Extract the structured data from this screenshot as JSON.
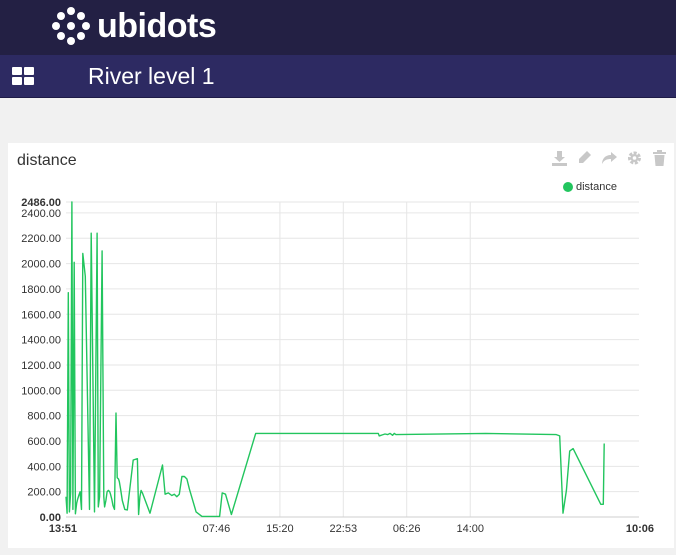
{
  "app": {
    "brand": "ubidots",
    "page_title": "River level 1"
  },
  "widget": {
    "title": "distance",
    "tools": [
      "download-icon",
      "edit-icon",
      "share-icon",
      "gear-icon",
      "trash-icon"
    ]
  },
  "colors": {
    "topbar": "#232044",
    "subbar": "#2d2a62",
    "series": "#22c55e"
  },
  "chart_data": {
    "type": "line",
    "title": "",
    "xlabel": "",
    "ylabel": "",
    "ylim": [
      0,
      2486
    ],
    "y_max_label": "2486.00",
    "yticks": [
      "0.00",
      "200.00",
      "400.00",
      "600.00",
      "800.00",
      "1000.00",
      "1200.00",
      "1400.00",
      "1600.00",
      "1800.00",
      "2000.00",
      "2200.00",
      "2400.00"
    ],
    "ytick_values": [
      0,
      200,
      400,
      600,
      800,
      1000,
      1200,
      1400,
      1600,
      1800,
      2000,
      2200,
      2400
    ],
    "x_labels": [
      "13:51",
      "07:46",
      "15:20",
      "22:53",
      "06:26",
      "14:00",
      "10:06"
    ],
    "x_label_hours": [
      0,
      17.92,
      25.48,
      33.03,
      40.58,
      48.15,
      68.25
    ],
    "bold_x_labels": [
      "13:51",
      "10:06"
    ],
    "x_unit": "hours since 13:51",
    "xlim": [
      0,
      68.25
    ],
    "grid": true,
    "legend": "top-right",
    "series": [
      {
        "name": "distance",
        "color": "#22c55e",
        "x": [
          0.0,
          0.13,
          0.27,
          0.4,
          0.55,
          0.7,
          0.82,
          0.98,
          1.12,
          1.28,
          1.38,
          1.52,
          1.68,
          1.85,
          2.0,
          2.3,
          2.8,
          3.0,
          3.4,
          3.7,
          3.85,
          4.0,
          4.3,
          4.5,
          4.6,
          4.75,
          4.9,
          5.05,
          5.2,
          5.3,
          5.45,
          5.6,
          5.78,
          5.95,
          6.1,
          6.25,
          6.35,
          6.5,
          6.7,
          7.0,
          7.3,
          8.0,
          8.5,
          8.65,
          8.8,
          8.95,
          9.1,
          10.0,
          11.5,
          11.8,
          12.2,
          12.6,
          12.9,
          13.2,
          13.5,
          13.8,
          14.1,
          14.4,
          14.7,
          15.5,
          16.2,
          16.4,
          16.6,
          16.8,
          17.0,
          17.3,
          18.2,
          18.3,
          18.6,
          19.0,
          19.7,
          22.6,
          37.2,
          37.3,
          38.0,
          38.3,
          38.6,
          38.9,
          39.1,
          39.3,
          50.0,
          58.4,
          58.8,
          59.2,
          59.6,
          60.0,
          60.4,
          63.7,
          64.0,
          64.1
        ],
        "y": [
          160,
          30,
          1770,
          40,
          190,
          2486,
          60,
          2010,
          25,
          110,
          140,
          170,
          200,
          60,
          2080,
          1900,
          60,
          2240,
          40,
          2240,
          80,
          160,
          2100,
          160,
          80,
          130,
          200,
          210,
          200,
          180,
          140,
          90,
          60,
          820,
          310,
          300,
          280,
          220,
          130,
          60,
          55,
          450,
          460,
          20,
          160,
          210,
          190,
          30,
          410,
          180,
          190,
          170,
          180,
          160,
          180,
          320,
          320,
          300,
          220,
          40,
          5,
          5,
          5,
          5,
          5,
          5,
          5,
          5,
          190,
          180,
          20,
          660,
          660,
          640,
          655,
          650,
          660,
          645,
          660,
          650,
          660,
          650,
          640,
          30,
          210,
          520,
          540,
          100,
          100,
          580
        ]
      }
    ]
  }
}
